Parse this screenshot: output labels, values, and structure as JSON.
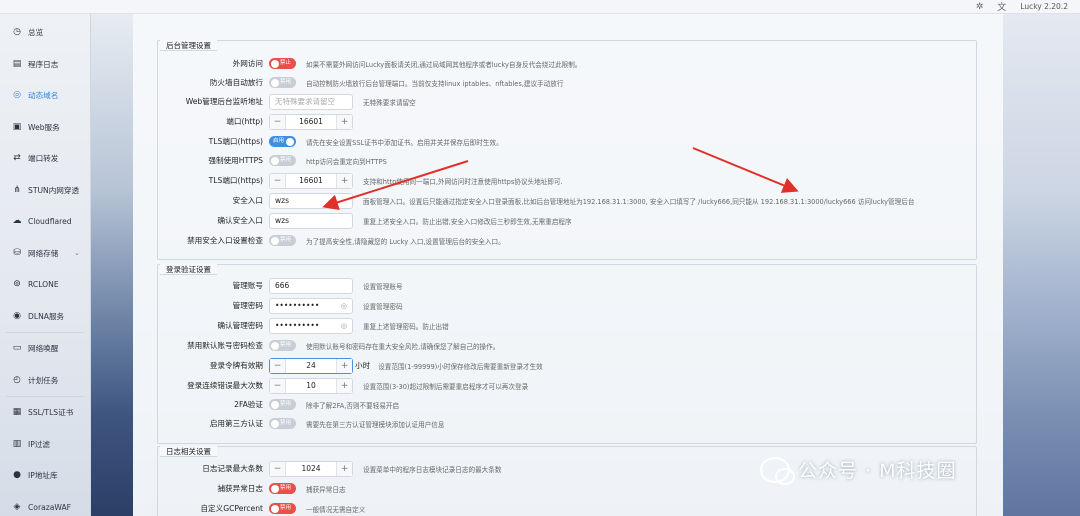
{
  "topbar": {
    "version": "Lucky 2.20.2",
    "icons": [
      "bug-icon",
      "translate-icon"
    ]
  },
  "sidebar": {
    "items": [
      {
        "label": "总览",
        "icon": "dashboard-icon"
      },
      {
        "label": "程序日志",
        "icon": "log-icon"
      },
      {
        "label": "动态域名",
        "icon": "ddns-icon",
        "active": true
      },
      {
        "label": "Web服务",
        "icon": "web-icon"
      },
      {
        "label": "端口转发",
        "icon": "forward-icon"
      },
      {
        "label": "STUN内网穿透",
        "icon": "stun-icon"
      },
      {
        "label": "Cloudflared",
        "icon": "cloud-icon"
      },
      {
        "label": "网络存储",
        "icon": "storage-icon",
        "chevron": true
      },
      {
        "label": "RCLONE",
        "icon": "rclone-icon"
      },
      {
        "label": "DLNA服务",
        "icon": "dlna-icon"
      },
      {
        "label": "网络唤醒",
        "icon": "wake-icon"
      },
      {
        "label": "计划任务",
        "icon": "clock-icon"
      },
      {
        "label": "SSL/TLS证书",
        "icon": "cert-icon"
      },
      {
        "label": "IP过滤",
        "icon": "filter-icon"
      },
      {
        "label": "IP地址库",
        "icon": "ip-db-icon"
      },
      {
        "label": "CorazaWAF",
        "icon": "waf-icon"
      }
    ]
  },
  "admin": {
    "title": "后台管理设置",
    "rows": {
      "external": {
        "label": "外网访问",
        "toggle": "禁止",
        "desc": "如果不需要外网访问Lucky面板请关闭,通过局域网其他程序或者lucky自身反代会绕过此限制。"
      },
      "firewall": {
        "label": "防火墙自动放行",
        "toggle": "禁用",
        "desc": "自动控制防火墙放行后台管理端口。当前仅支持linux iptables、nftables,建议手动放行"
      },
      "listen": {
        "label": "Web管理后台监听地址",
        "placeholder": "无特殊要求请留空",
        "desc": "无特殊要求请留空"
      },
      "port": {
        "label": "端口(http)",
        "value": "16601"
      },
      "tls": {
        "label": "TLS端口(https)",
        "toggle": "启用",
        "desc": "请先在安全设置SSL证书中添加证书。启用并关并保存后即时生效。"
      },
      "force_https": {
        "label": "强制使用HTTPS",
        "toggle": "禁用",
        "desc": "http访问会重定向到HTTPS"
      },
      "tls_port": {
        "label": "TLS端口(https)",
        "value": "16601",
        "desc": "支持和http使用同一端口,外网访问时注意使用https协议头地址即可."
      },
      "safe_entry": {
        "label": "安全入口",
        "value": "wzs",
        "desc": "面板管理入口。设置后只能通过指定安全入口登录面板,比如后台管理地址为192.168.31.1:3000, 安全入口填写了 /lucky666,同只能从 192.168.31.1:3000/lucky666 访问lucky管理后台"
      },
      "confirm_entry": {
        "label": "确认安全入口",
        "value": "wzs",
        "desc": "重复上述安全入口。防止出错,安全入口修改后三秒即生效,无需重启程序"
      },
      "disable_check": {
        "label": "禁用安全入口设置检查",
        "toggle": "禁用",
        "desc": "为了提高安全性,请隐藏您的 Lucky 入口,设置管理后台的安全入口。"
      }
    }
  },
  "login": {
    "title": "登录验证设置",
    "rows": {
      "account": {
        "label": "管理账号",
        "value": "666",
        "desc": "设置管理账号"
      },
      "password": {
        "label": "管理密码",
        "value": "••••••••••",
        "desc": "设置管理密码"
      },
      "confirm_password": {
        "label": "确认管理密码",
        "value": "••••••••••",
        "desc": "重复上述管理密码。防止出错"
      },
      "disable_default": {
        "label": "禁用默认账号密码检查",
        "toggle": "禁用",
        "desc": "使用默认账号和密码存在重大安全风险,请确保您了解自己的操作。"
      },
      "token_expire": {
        "label": "登录令牌有效期",
        "value": "24",
        "unit": "小时",
        "desc": "设置范围(1-99999)小时保存修改后需要重新登录才生效"
      },
      "max_errors": {
        "label": "登录连续错误最大次数",
        "value": "10",
        "desc": "设置范围(3-30)超过限制后需要重启程序才可以再次登录"
      },
      "twofa": {
        "label": "2FA验证",
        "toggle": "禁用",
        "desc": "除非了解2FA,否则不要轻易开启"
      },
      "thirdparty": {
        "label": "启用第三方认证",
        "toggle": "禁用",
        "desc": "需要先在第三方认证管理模块添加认证用户信息"
      }
    }
  },
  "logs": {
    "title": "日志相关设置",
    "rows": {
      "max_entries": {
        "label": "日志记录最大条数",
        "value": "1024",
        "desc": "设置菜单中的程序日志模块记录日志的最大条数"
      },
      "capture": {
        "label": "捕获异常日志",
        "toggle": "禁用",
        "desc": "捕获异常日志"
      },
      "gc": {
        "label": "自定义GCPercent",
        "toggle": "禁用",
        "desc": "一般情况无需自定义"
      }
    }
  },
  "watermark": {
    "text": "公众号 · M科技圈"
  }
}
